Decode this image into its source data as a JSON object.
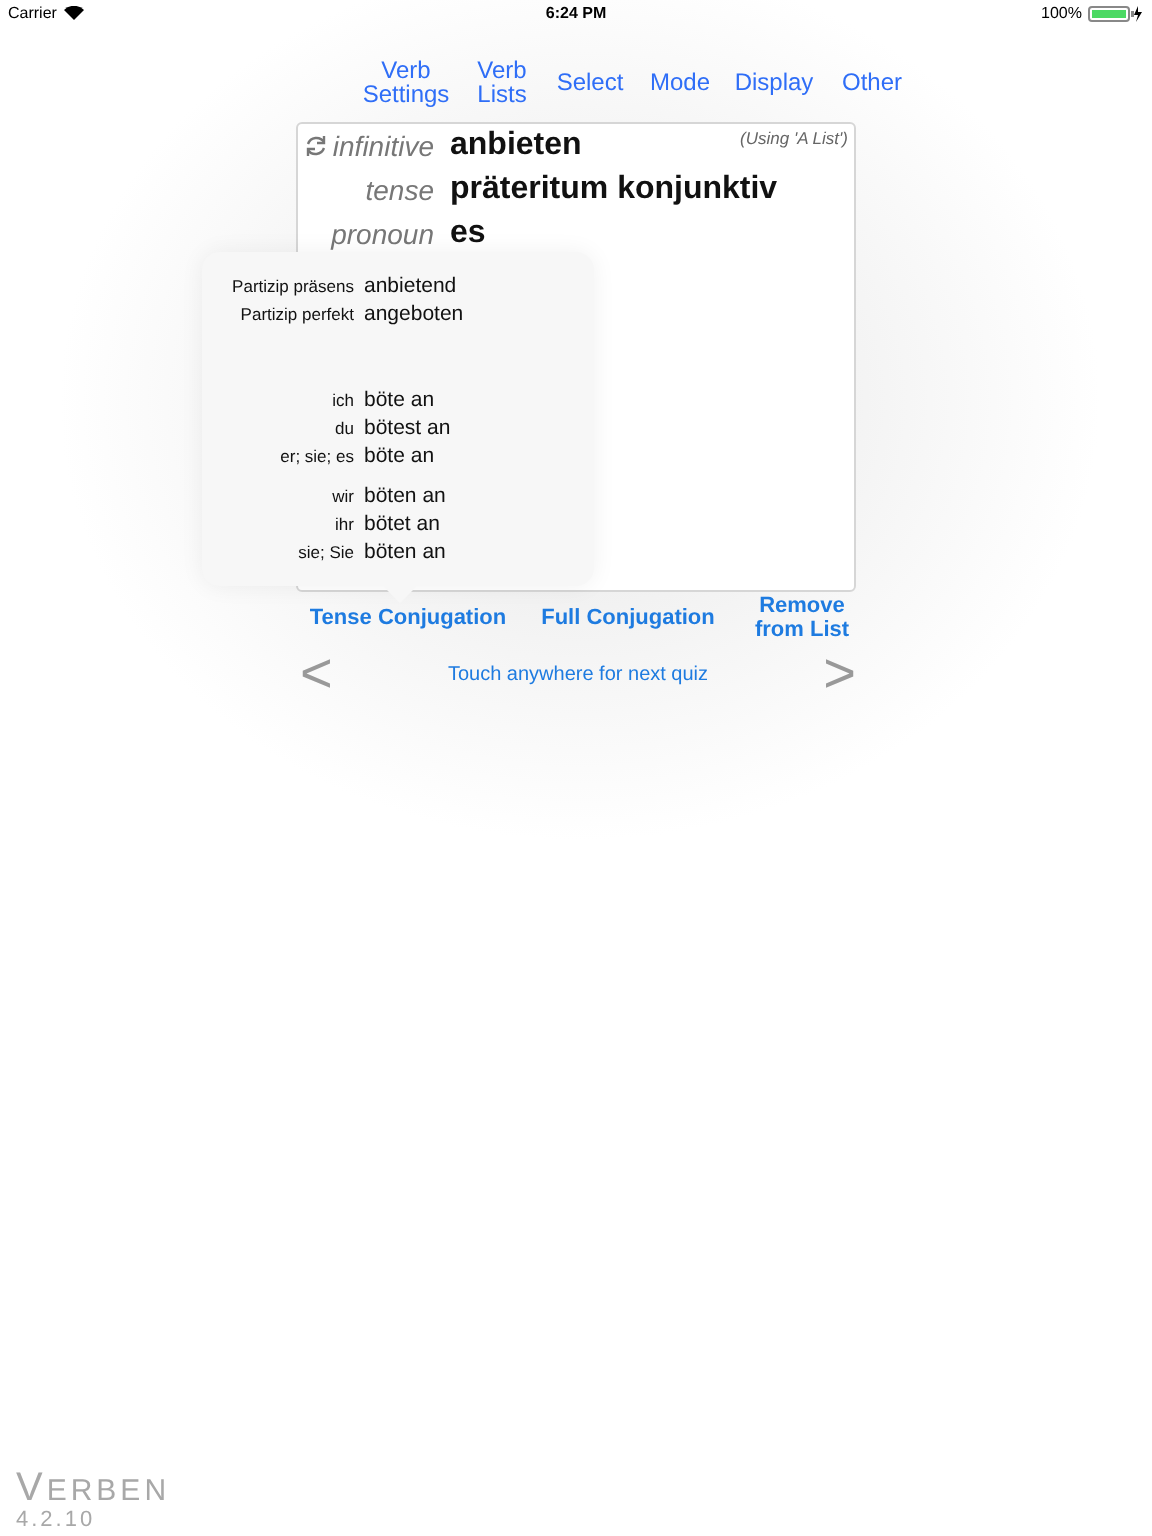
{
  "status_bar": {
    "carrier": "Carrier",
    "time": "6:24 PM",
    "battery": "100%"
  },
  "toolbar": [
    {
      "label": "Verb Settings"
    },
    {
      "label": "Verb Lists"
    },
    {
      "label": "Select"
    },
    {
      "label": "Mode"
    },
    {
      "label": "Display"
    },
    {
      "label": "Other"
    }
  ],
  "quiz_card": {
    "list_note": "(Using 'A List')",
    "rows": [
      {
        "kind": "refreshable",
        "label": "infinitive",
        "value": "anbieten"
      },
      {
        "kind": "plain",
        "label": "tense",
        "value": "präteritum konjunktiv"
      },
      {
        "kind": "plain",
        "label": "pronoun",
        "value": "es"
      }
    ]
  },
  "popover": {
    "participles": [
      {
        "label": "Partizip präsens",
        "value": "anbietend"
      },
      {
        "label": "Partizip perfekt",
        "value": "angeboten"
      }
    ],
    "groups": [
      [
        {
          "label": "ich",
          "value": "böte an"
        },
        {
          "label": "du",
          "value": "bötest an"
        },
        {
          "label": "er; sie; es",
          "value": "böte an"
        }
      ],
      [
        {
          "label": "wir",
          "value": "böten an"
        },
        {
          "label": "ihr",
          "value": "bötet an"
        },
        {
          "label": "sie; Sie",
          "value": "böten an"
        }
      ]
    ]
  },
  "actions": [
    "Tense Conjugation",
    "Full Conjugation",
    "Remove from List"
  ],
  "nav": {
    "previous": "<",
    "hint": "Touch anywhere for next quiz",
    "next": ">"
  },
  "logo": {
    "name": "VERBEN",
    "version": "4.2.10"
  }
}
